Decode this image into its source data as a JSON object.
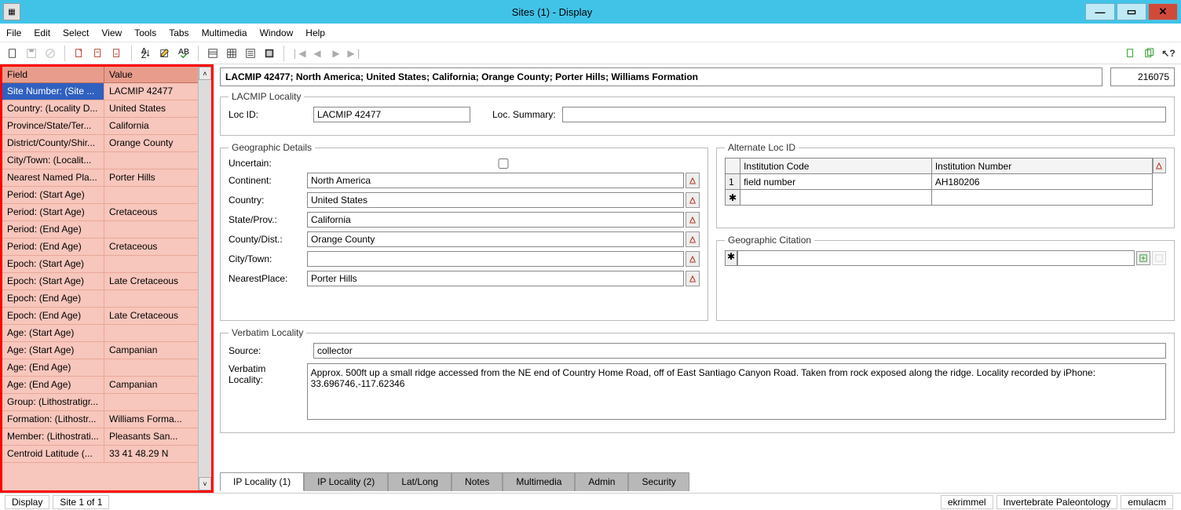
{
  "window": {
    "title": "Sites (1) - Display"
  },
  "menu": [
    "File",
    "Edit",
    "Select",
    "View",
    "Tools",
    "Tabs",
    "Multimedia",
    "Window",
    "Help"
  ],
  "side": {
    "headers": [
      "Field",
      "Value"
    ],
    "rows": [
      {
        "f": "Site Number: (Site ...",
        "v": "LACMIP 42477",
        "sel": true
      },
      {
        "f": "Country: (Locality D...",
        "v": "United States"
      },
      {
        "f": "Province/State/Ter...",
        "v": "California"
      },
      {
        "f": "District/County/Shir...",
        "v": "Orange County"
      },
      {
        "f": "City/Town: (Localit...",
        "v": ""
      },
      {
        "f": "Nearest Named Pla...",
        "v": "Porter Hills"
      },
      {
        "f": "Period: (Start Age)",
        "v": ""
      },
      {
        "f": "Period: (Start Age)",
        "v": "Cretaceous"
      },
      {
        "f": "Period: (End Age)",
        "v": ""
      },
      {
        "f": "Period: (End Age)",
        "v": "Cretaceous"
      },
      {
        "f": "Epoch: (Start Age)",
        "v": ""
      },
      {
        "f": "Epoch: (Start Age)",
        "v": "Late Cretaceous"
      },
      {
        "f": "Epoch: (End Age)",
        "v": ""
      },
      {
        "f": "Epoch: (End Age)",
        "v": "Late Cretaceous"
      },
      {
        "f": "Age: (Start Age)",
        "v": ""
      },
      {
        "f": "Age: (Start Age)",
        "v": "Campanian"
      },
      {
        "f": "Age: (End Age)",
        "v": ""
      },
      {
        "f": "Age: (End Age)",
        "v": "Campanian"
      },
      {
        "f": "Group: (Lithostratigr...",
        "v": ""
      },
      {
        "f": "Formation: (Lithostr...",
        "v": "Williams Forma..."
      },
      {
        "f": "Member: (Lithostrati...",
        "v": "Pleasants San..."
      },
      {
        "f": "Centroid Latitude (...",
        "v": "33 41 48.29 N"
      }
    ]
  },
  "header": {
    "summary": "LACMIP 42477; North America; United States; California; Orange County; Porter Hills; Williams Formation",
    "recordId": "216075"
  },
  "locality": {
    "legend": "LACMIP Locality",
    "locIdLabel": "Loc ID:",
    "locIdPrefix": "LACMIP ",
    "locIdNum": "42477",
    "locSummaryLabel": "Loc. Summary:",
    "locSummary": ""
  },
  "geo": {
    "legend": "Geographic Details",
    "uncertainLabel": "Uncertain:",
    "continentLabel": "Continent:",
    "continent": "North America",
    "countryLabel": "Country:",
    "country": "United States",
    "stateLabel": "State/Prov.:",
    "state": "California",
    "countyLabel": "County/Dist.:",
    "county": "Orange County",
    "cityLabel": "City/Town:",
    "city": "",
    "nearestLabel": "NearestPlace:",
    "nearest": "Porter Hills"
  },
  "alt": {
    "legend": "Alternate Loc ID",
    "headers": [
      "Institution Code",
      "Institution Number"
    ],
    "rows": [
      {
        "n": "1",
        "code": "field number",
        "num": "AH180206"
      }
    ]
  },
  "geoCitation": {
    "legend": "Geographic Citation"
  },
  "verbatim": {
    "legend": "Verbatim Locality",
    "sourceLabel": "Source:",
    "source": "collector",
    "locLabel": "Verbatim Locality:",
    "loc": "Approx. 500ft up a small ridge accessed from the NE end of Country Home Road, off of East Santiago Canyon Road. Taken from rock exposed along the ridge. Locality recorded by iPhone: 33.696746,-117.62346"
  },
  "tabs": [
    "IP Locality (1)",
    "IP Locality (2)",
    "Lat/Long",
    "Notes",
    "Multimedia",
    "Admin",
    "Security"
  ],
  "status": {
    "mode": "Display",
    "record": "Site 1 of 1",
    "user": "ekrimmel",
    "dept": "Invertebrate Paleontology",
    "db": "emulacm"
  }
}
